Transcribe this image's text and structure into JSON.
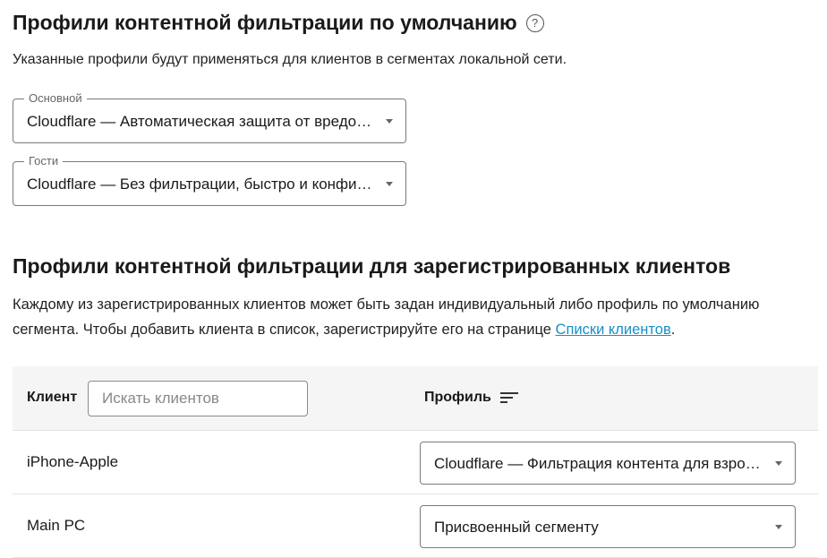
{
  "defaults": {
    "title": "Профили контентной фильтрации по умолчанию",
    "help_icon": "?",
    "description": "Указанные профили будут применяться для клиентов в сегментах локальной сети.",
    "selects": [
      {
        "label": "Основной",
        "value": "Cloudflare — Автоматическая защита от вредоносных сайтов"
      },
      {
        "label": "Гости",
        "value": "Cloudflare — Без фильтрации, быстро и конфиденциально"
      }
    ]
  },
  "registered": {
    "title": "Профили контентной фильтрации для зарегистрированных клиентов",
    "description_before_link": "Каждому из зарегистрированных клиентов может быть задан индивидуальный либо профиль по умолчанию сегмента. Чтобы добавить клиента в список, зарегистрируйте его на странице ",
    "link_text": "Списки клиентов",
    "description_after_link": ".",
    "table": {
      "client_header": "Клиент",
      "search_placeholder": "Искать клиентов",
      "search_value": "",
      "profile_header": "Профиль",
      "rows": [
        {
          "client": "iPhone-Apple",
          "profile": "Cloudflare — Фильтрация контента для взрослых"
        },
        {
          "client": "Main PC",
          "profile": "Присвоенный сегменту"
        }
      ]
    }
  },
  "icons": {
    "help": "help-circle-icon",
    "sort": "sort-icon",
    "dropdown": "caret-down-icon"
  },
  "colors": {
    "link": "#1a8fc7",
    "table_header_bg": "#f5f5f5",
    "border": "#7a7a7a"
  }
}
